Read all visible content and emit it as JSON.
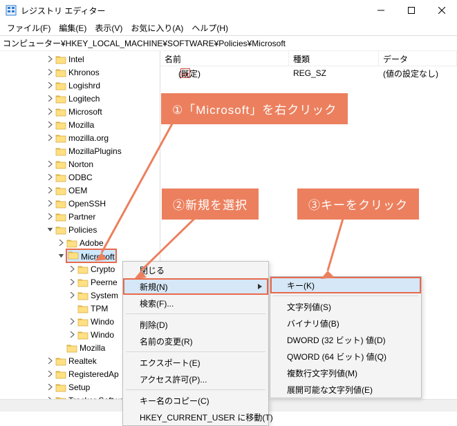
{
  "window": {
    "title": "レジストリ エディター"
  },
  "menu": [
    "ファイル(F)",
    "編集(E)",
    "表示(V)",
    "お気に入り(A)",
    "ヘルプ(H)"
  ],
  "address": "コンピューター¥HKEY_LOCAL_MACHINE¥SOFTWARE¥Policies¥Microsoft",
  "columns": [
    "名前",
    "種類",
    "データ"
  ],
  "values": [
    {
      "name": "(既定)",
      "type": "REG_SZ",
      "data": "(値の設定なし)"
    }
  ],
  "tree": [
    {
      "indent": 4,
      "exp": ">",
      "label": "Intel"
    },
    {
      "indent": 4,
      "exp": ">",
      "label": "Khronos"
    },
    {
      "indent": 4,
      "exp": ">",
      "label": "Logishrd"
    },
    {
      "indent": 4,
      "exp": ">",
      "label": "Logitech"
    },
    {
      "indent": 4,
      "exp": ">",
      "label": "Microsoft"
    },
    {
      "indent": 4,
      "exp": ">",
      "label": "Mozilla"
    },
    {
      "indent": 4,
      "exp": ">",
      "label": "mozilla.org"
    },
    {
      "indent": 4,
      "exp": "",
      "label": "MozillaPlugins"
    },
    {
      "indent": 4,
      "exp": ">",
      "label": "Norton"
    },
    {
      "indent": 4,
      "exp": ">",
      "label": "ODBC"
    },
    {
      "indent": 4,
      "exp": ">",
      "label": "OEM"
    },
    {
      "indent": 4,
      "exp": ">",
      "label": "OpenSSH"
    },
    {
      "indent": 4,
      "exp": ">",
      "label": "Partner"
    },
    {
      "indent": 4,
      "exp": "v",
      "label": "Policies"
    },
    {
      "indent": 5,
      "exp": ">",
      "label": "Adobe"
    },
    {
      "indent": 5,
      "exp": "v",
      "label": "Microsoft",
      "selected": true,
      "highlighted": true
    },
    {
      "indent": 6,
      "exp": ">",
      "label": "Crypto"
    },
    {
      "indent": 6,
      "exp": ">",
      "label": "Peerne"
    },
    {
      "indent": 6,
      "exp": ">",
      "label": "System"
    },
    {
      "indent": 6,
      "exp": "",
      "label": "TPM"
    },
    {
      "indent": 6,
      "exp": ">",
      "label": "Windo"
    },
    {
      "indent": 6,
      "exp": ">",
      "label": "Windo"
    },
    {
      "indent": 5,
      "exp": "",
      "label": "Mozilla"
    },
    {
      "indent": 4,
      "exp": ">",
      "label": "Realtek"
    },
    {
      "indent": 4,
      "exp": ">",
      "label": "RegisteredAp"
    },
    {
      "indent": 4,
      "exp": ">",
      "label": "Setup"
    },
    {
      "indent": 4,
      "exp": ">",
      "label": "Tracker Softwa"
    }
  ],
  "contextMenu": [
    {
      "label": "閉じる"
    },
    {
      "label": "新規(N)",
      "submenu": true,
      "hover": true,
      "highlighted": true
    },
    {
      "label": "検索(F)..."
    },
    {
      "sep": true
    },
    {
      "label": "削除(D)"
    },
    {
      "label": "名前の変更(R)"
    },
    {
      "sep": true
    },
    {
      "label": "エクスポート(E)"
    },
    {
      "label": "アクセス許可(P)..."
    },
    {
      "sep": true
    },
    {
      "label": "キー名のコピー(C)"
    },
    {
      "label": "HKEY_CURRENT_USER に移動(T)"
    }
  ],
  "subMenu": [
    {
      "label": "キー(K)",
      "hover": true,
      "highlighted": true
    },
    {
      "sep": true
    },
    {
      "label": "文字列値(S)"
    },
    {
      "label": "バイナリ値(B)"
    },
    {
      "label": "DWORD (32 ビット) 値(D)"
    },
    {
      "label": "QWORD (64 ビット) 値(Q)"
    },
    {
      "label": "複数行文字列値(M)"
    },
    {
      "label": "展開可能な文字列値(E)"
    }
  ],
  "callouts": [
    "①「Microsoft」を右クリック",
    "②新規を選択",
    "③キーをクリック"
  ]
}
